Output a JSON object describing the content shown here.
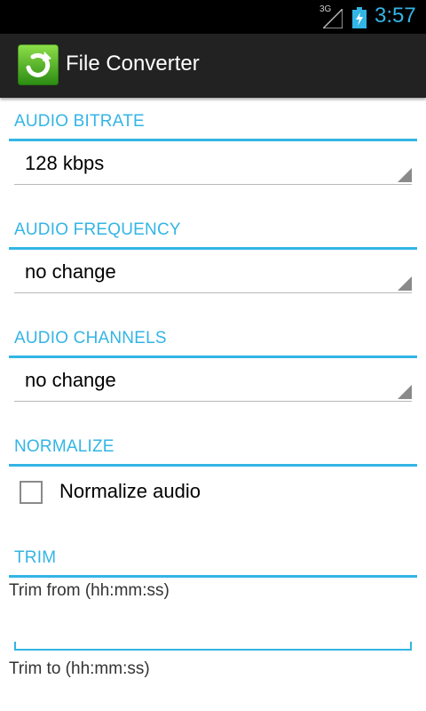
{
  "status_bar": {
    "network_type": "3G",
    "time": "3:57"
  },
  "action_bar": {
    "title": "File Converter",
    "icon": "refresh-arrow-app-icon"
  },
  "sections": {
    "audio_bitrate": {
      "header": "AUDIO BITRATE",
      "value": "128 kbps"
    },
    "audio_frequency": {
      "header": "AUDIO FREQUENCY",
      "value": "no change"
    },
    "audio_channels": {
      "header": "AUDIO CHANNELS",
      "value": "no change"
    },
    "normalize": {
      "header": "NORMALIZE",
      "checkbox_label": "Normalize audio",
      "checked": false
    },
    "trim": {
      "header": "TRIM",
      "from_label": "Trim from (hh:mm:ss)",
      "from_value": "",
      "to_label": "Trim to (hh:mm:ss)"
    }
  },
  "colors": {
    "accent": "#33b5e5",
    "action_bar": "#222222",
    "status_bar": "#000000"
  }
}
